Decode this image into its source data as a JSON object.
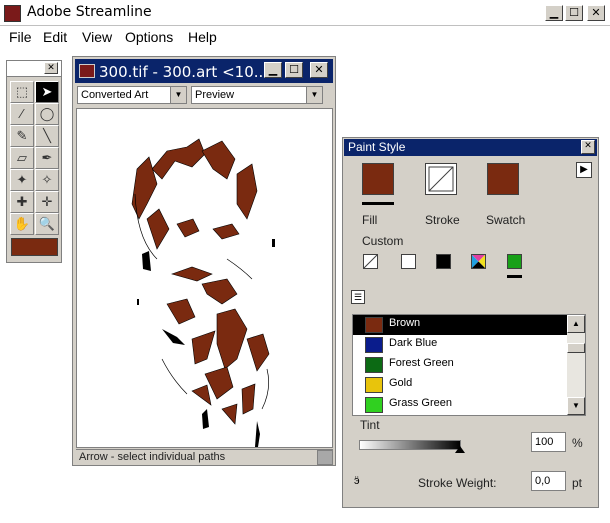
{
  "app": {
    "title": "Adobe Streamline"
  },
  "caption_buttons": {
    "minimize": "▁",
    "maximize": "☐",
    "close": "✕"
  },
  "menu": [
    "File",
    "Edit",
    "View",
    "Options",
    "Help"
  ],
  "tools": {
    "icons": [
      "marquee-icon",
      "arrow-icon",
      "magic-wand-icon",
      "lasso-icon",
      "pencil-icon",
      "line-icon",
      "eraser-icon",
      "eyedropper-icon",
      "pen-add-icon",
      "pen-icon",
      "pen-plus-icon",
      "pen-minus-icon",
      "hand-icon",
      "zoom-icon"
    ],
    "glyphs": [
      "⬚",
      "➤",
      "⁄",
      "◯",
      "✎",
      "╲",
      "▱",
      "✒",
      "✦",
      "✧",
      "✚",
      "✛",
      "✋",
      "🔍"
    ],
    "swatch_color": "#7a2a10"
  },
  "document": {
    "title": "300.tif - 300.art  <10...",
    "mode_select": "Converted Art",
    "view_select": "Preview",
    "status": "Arrow - select individual paths"
  },
  "paint_style": {
    "title": "Paint Style",
    "fill_label": "Fill",
    "stroke_label": "Stroke",
    "swatch_label": "Swatch",
    "fill_color": "#7a2a10",
    "swatch_color": "#7a2a10",
    "custom_label": "Custom",
    "colors": [
      {
        "name": "Brown",
        "color": "#7a2a10"
      },
      {
        "name": "Dark Blue",
        "color": "#0a1c8c"
      },
      {
        "name": "Forest Green",
        "color": "#0c6a14"
      },
      {
        "name": "Gold",
        "color": "#e8c40c"
      },
      {
        "name": "Grass Green",
        "color": "#30d020"
      }
    ],
    "tint_label": "Tint",
    "tint_value": "100",
    "tint_unit": "%",
    "stroke_weight_label": "Stroke Weight:",
    "stroke_weight_value": "0,0",
    "stroke_weight_unit": "pt"
  }
}
